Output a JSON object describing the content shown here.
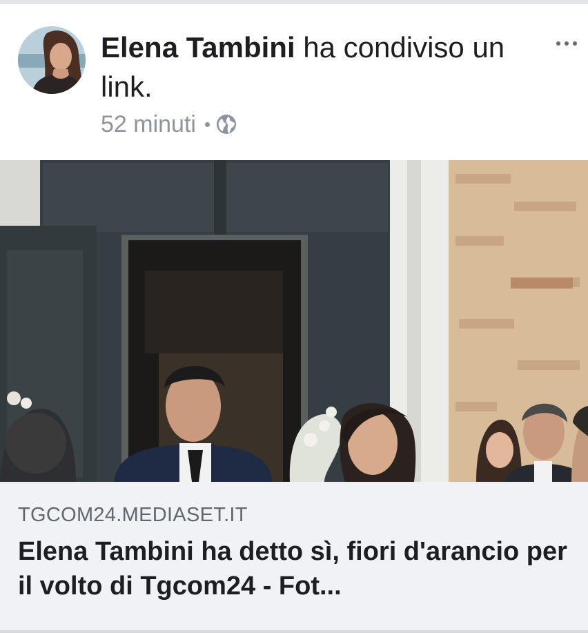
{
  "post": {
    "author": "Elena Tambini",
    "action": " ha condiviso un link.",
    "time": "52 minuti",
    "separator": "•",
    "privacy_icon": "globe-icon",
    "more_icon": "more-options-icon"
  },
  "link": {
    "domain": "TGCOM24.MEDIASET.IT",
    "title": "Elena Tambini ha detto sì, fiori d'arancio per il volto di Tgcom24 - Fot..."
  },
  "colors": {
    "text_primary": "#1c1e21",
    "text_secondary": "#8d949e",
    "link_box_bg": "#f0f2f5"
  }
}
